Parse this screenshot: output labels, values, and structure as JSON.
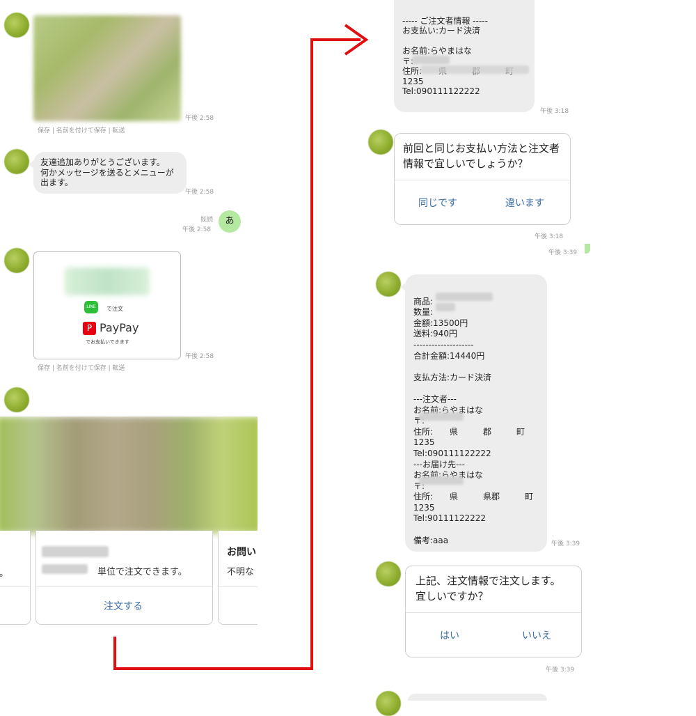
{
  "left": {
    "time_1": "午後 2:58",
    "actions_1": "保存 | 名前を付けて保存 | 転送",
    "greeting": "友達追加ありがとうございます。\n何かメッセージを送るとメニューが出ます。",
    "time_2": "午後 2:58",
    "read_label": "既読",
    "time_3": "午後 2:58",
    "user_msg": "あ",
    "line_order_caption": "で注文",
    "paypay_label": "PayPay",
    "paypay_caption": "でお支払いできます",
    "time_4": "午後 2:58",
    "actions_2": "保存 | 名前を付けて保存 | 転送",
    "carousel_left_fragment": "。",
    "carousel_mid_desc": "単位で注文できます。",
    "carousel_mid_button": "注文する",
    "carousel_right_title": "お問い",
    "carousel_right_desc": "不明な"
  },
  "right": {
    "orderer_info": "----- ご注文者情報 -----\nお支払い:カード決済\n\nお名前:らやまはな\n〒:\n住所:　　県　　　郡　　　町\n1235\nTel:090111122222",
    "time_1": "午後 3:18",
    "confirm_q": "前回と同じお支払い方法と注文者情報で宜しいでしょうか？",
    "confirm_yes": "同じです",
    "confirm_no": "違います",
    "time_2": "午後 3:18",
    "time_3": "午後 3:39",
    "summary": "商品:\n数量:\n金額:13500円\n送料:940円\n--------------------\n合計金額:14440円\n\n支払方法:カード決済\n\n---注文者---\nお名前:らやまはな\n〒:\n住所:　　県　　　郡　　　町\n1235\nTel:090111122222\n---お届け先---\nお名前:らやまはな\n〒:\n住所:　　県　　　県郡　　　町\n1235\nTel:90111122222\n\n備考:aaa",
    "time_4": "午後 3:39",
    "final_q": "上記、注文情報で注文します。\n宜しいですか？",
    "final_yes": "はい",
    "final_no": "いいえ",
    "time_5": "午後 3:39"
  },
  "colors": {
    "arrow": "#e01010",
    "link": "#3b6ea8",
    "bubble": "#ededed",
    "user_bubble": "#b5e8a0"
  }
}
